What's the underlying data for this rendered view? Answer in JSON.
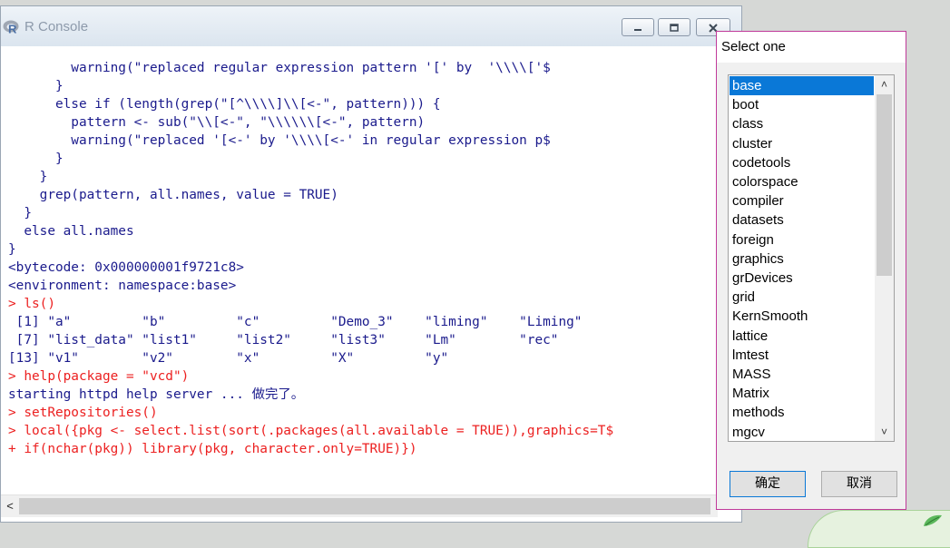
{
  "console": {
    "title": "R Console",
    "lines": [
      {
        "text": "        warning(\"replaced regular expression pattern '[' by  '\\\\\\\\['$",
        "color": "blue"
      },
      {
        "text": "      }",
        "color": "blue"
      },
      {
        "text": "      else if (length(grep(\"[^\\\\\\\\]\\\\[<-\", pattern))) {",
        "color": "blue"
      },
      {
        "text": "        pattern <- sub(\"\\\\[<-\", \"\\\\\\\\\\\\[<-\", pattern)",
        "color": "blue"
      },
      {
        "text": "        warning(\"replaced '[<-' by '\\\\\\\\[<-' in regular expression p$",
        "color": "blue"
      },
      {
        "text": "      }",
        "color": "blue"
      },
      {
        "text": "    }",
        "color": "blue"
      },
      {
        "text": "    grep(pattern, all.names, value = TRUE)",
        "color": "blue"
      },
      {
        "text": "  }",
        "color": "blue"
      },
      {
        "text": "  else all.names",
        "color": "blue"
      },
      {
        "text": "}",
        "color": "blue"
      },
      {
        "text": "<bytecode: 0x000000001f9721c8>",
        "color": "blue"
      },
      {
        "text": "<environment: namespace:base>",
        "color": "blue"
      },
      {
        "text": "> ls()",
        "color": "red"
      },
      {
        "text": " [1] \"a\"         \"b\"         \"c\"         \"Demo_3\"    \"liming\"    \"Liming\"",
        "color": "blue"
      },
      {
        "text": " [7] \"list_data\" \"list1\"     \"list2\"     \"list3\"     \"Lm\"        \"rec\"",
        "color": "blue"
      },
      {
        "text": "[13] \"v1\"        \"v2\"        \"x\"         \"X\"         \"y\"",
        "color": "blue"
      },
      {
        "text": "> help(package = \"vcd\")",
        "color": "red"
      },
      {
        "text": "starting httpd help server ... ",
        "cjk": "做完了。",
        "color": "blue"
      },
      {
        "text": "> setRepositories()",
        "color": "red"
      },
      {
        "text": "> local({pkg <- select.list(sort(.packages(all.available = TRUE)),graphics=T$",
        "color": "red"
      },
      {
        "text": "+ if(nchar(pkg)) library(pkg, character.only=TRUE)})",
        "color": "red"
      }
    ],
    "hscroll_left": "<"
  },
  "dialog": {
    "title": "Select one",
    "items": [
      "base",
      "boot",
      "class",
      "cluster",
      "codetools",
      "colorspace",
      "compiler",
      "datasets",
      "foreign",
      "graphics",
      "grDevices",
      "grid",
      "KernSmooth",
      "lattice",
      "lmtest",
      "MASS",
      "Matrix",
      "methods",
      "mgcv"
    ],
    "selected_index": 0,
    "ok_label": "确定",
    "cancel_label": "取消",
    "scroll_up": "˄",
    "scroll_down": "˅"
  },
  "colors": {
    "console_text": "#1a1a8c",
    "console_input": "#ec2020",
    "selection": "#0a78d7",
    "dialog_border": "#c03a9a"
  },
  "icons": {
    "app": "r-logo-icon",
    "minimize": "minimize-icon",
    "maximize": "maximize-icon",
    "close": "close-icon"
  }
}
